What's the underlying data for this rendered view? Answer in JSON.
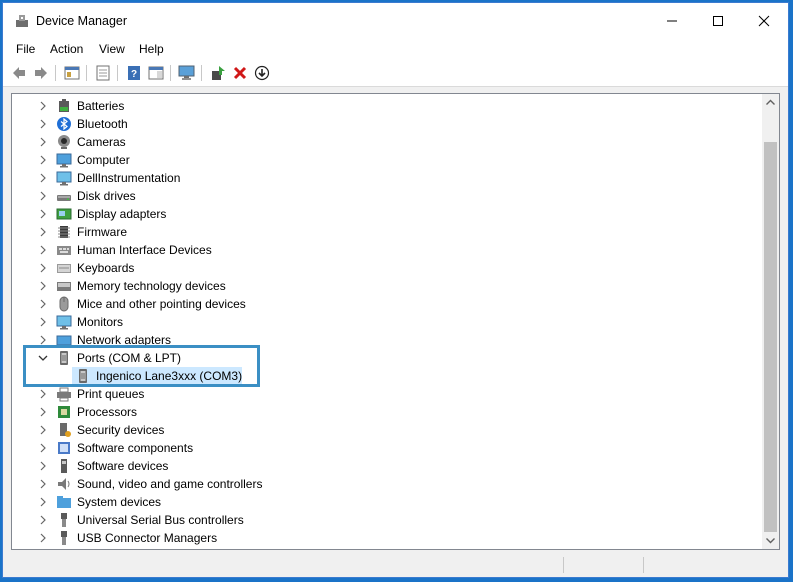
{
  "window": {
    "title": "Device Manager"
  },
  "titlebar": {
    "minimize_icon": "minimize-icon",
    "maximize_icon": "maximize-icon",
    "close_icon": "close-icon"
  },
  "menu": [
    "File",
    "Action",
    "View",
    "Help"
  ],
  "toolbar": {
    "icons": [
      "back-arrow-icon",
      "forward-arrow-icon",
      "show-hide-console-tree-icon",
      "properties-icon",
      "help-icon",
      "show-action-pane-icon",
      "scan-hardware-changes-icon",
      "update-driver-icon",
      "uninstall-device-icon",
      "download-driver-icon"
    ]
  },
  "tree": {
    "items": [
      {
        "label": "Batteries",
        "icon": "battery-icon"
      },
      {
        "label": "Bluetooth",
        "icon": "bluetooth-icon"
      },
      {
        "label": "Cameras",
        "icon": "camera-icon"
      },
      {
        "label": "Computer",
        "icon": "computer-icon"
      },
      {
        "label": "DellInstrumentation",
        "icon": "monitor-icon"
      },
      {
        "label": "Disk drives",
        "icon": "disk-drive-icon"
      },
      {
        "label": "Display adapters",
        "icon": "display-adapter-icon"
      },
      {
        "label": "Firmware",
        "icon": "chip-icon"
      },
      {
        "label": "Human Interface Devices",
        "icon": "hid-icon"
      },
      {
        "label": "Keyboards",
        "icon": "keyboard-icon"
      },
      {
        "label": "Memory technology devices",
        "icon": "memory-icon"
      },
      {
        "label": "Mice and other pointing devices",
        "icon": "mouse-icon"
      },
      {
        "label": "Monitors",
        "icon": "monitor-icon"
      },
      {
        "label": "Network adapters",
        "icon": "network-adapter-icon"
      },
      {
        "label": "Ports (COM & LPT)",
        "icon": "port-icon",
        "expanded": true
      },
      {
        "label": "Ingenico Lane3xxx (COM3)",
        "icon": "port-icon",
        "child": true,
        "selected": true
      },
      {
        "label": "Print queues",
        "icon": "printer-icon"
      },
      {
        "label": "Processors",
        "icon": "processor-icon"
      },
      {
        "label": "Security devices",
        "icon": "security-key-icon"
      },
      {
        "label": "Software components",
        "icon": "software-component-icon"
      },
      {
        "label": "Software devices",
        "icon": "software-device-icon"
      },
      {
        "label": "Sound, video and game controllers",
        "icon": "speaker-icon"
      },
      {
        "label": "System devices",
        "icon": "system-folder-icon"
      },
      {
        "label": "Universal Serial Bus controllers",
        "icon": "usb-icon"
      },
      {
        "label": "USB Connector Managers",
        "icon": "usb-icon"
      }
    ]
  },
  "scrollbar": {
    "up_icon": "scroll-up-icon",
    "down_icon": "scroll-down-icon"
  }
}
